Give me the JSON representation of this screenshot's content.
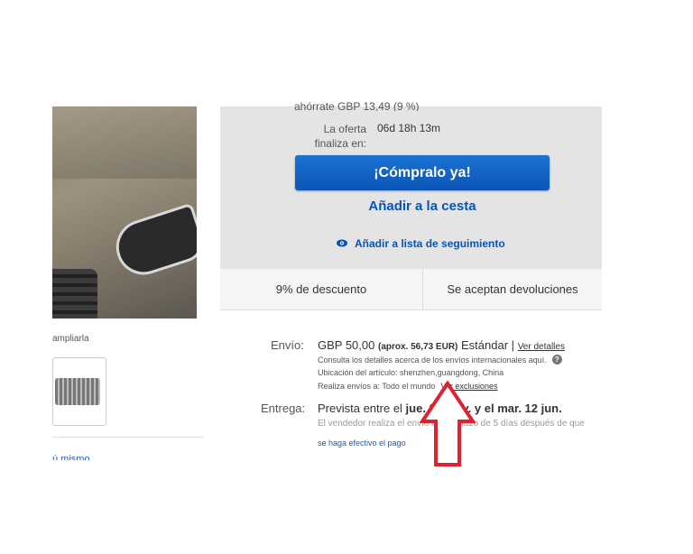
{
  "left": {
    "enlarge_text": "ampliarla",
    "cut_link": "ú mismo"
  },
  "buybox": {
    "savings": "ahórrate GBP  13,49 (9 %)",
    "offer_label": "La oferta finaliza en:",
    "offer_time": "06d 18h 13m",
    "buy_now": "¡Cómpralo ya!",
    "add_to_cart": "Añadir a la cesta",
    "watchlist": "Añadir a lista de seguimiento",
    "discount": "9% de descuento",
    "returns": "Se aceptan devoluciones"
  },
  "shipping": {
    "label": "Envío:",
    "price": "GBP 50,00",
    "approx": "(aprox. 56,73 EUR)",
    "service": "Estándar",
    "separator": "|",
    "details_link": "Ver detalles",
    "intl_note": "Consulta los detalles acerca de los envíos internacionales aquí.",
    "location": "Ubicación del artículo:  shenzhen,guangdong, China",
    "ships_to": "Realiza envíos a:  Todo el mundo",
    "exclusions_link": "Ver exclusiones"
  },
  "delivery": {
    "label": "Entrega:",
    "prefix": "Prevista entre el ",
    "dates": "jue. 25 may. y el mar. 12 jun.",
    "seller_note": "El vendedor realiza el envío en un plazo de 5 días después de que",
    "payment_note": "se haga efectivo el pago"
  },
  "icons": {
    "watch": "eye-icon",
    "help": "question-icon",
    "annotation": "red-up-arrow"
  },
  "colors": {
    "primary_button": "#0b55b5",
    "link": "#0654ba",
    "annotation": "#e0212f"
  }
}
